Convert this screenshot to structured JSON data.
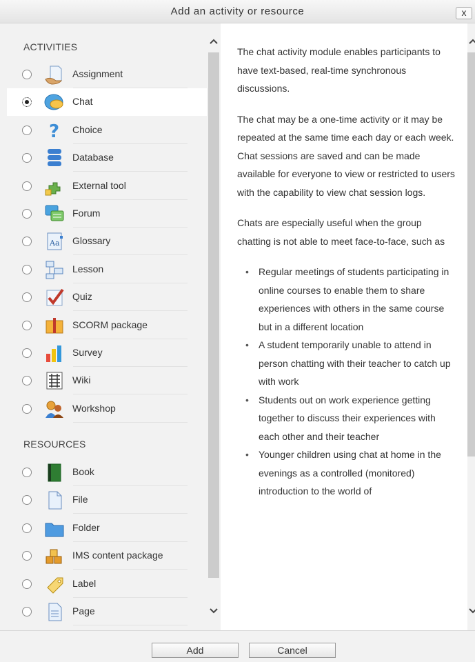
{
  "dialog": {
    "title": "Add an activity or resource",
    "close_label": "x"
  },
  "activities": {
    "heading": "ACTIVITIES",
    "items": [
      {
        "label": "Assignment",
        "icon": "assignment-icon",
        "selected": false
      },
      {
        "label": "Chat",
        "icon": "chat-icon",
        "selected": true
      },
      {
        "label": "Choice",
        "icon": "choice-icon",
        "selected": false
      },
      {
        "label": "Database",
        "icon": "database-icon",
        "selected": false
      },
      {
        "label": "External tool",
        "icon": "external-tool-icon",
        "selected": false
      },
      {
        "label": "Forum",
        "icon": "forum-icon",
        "selected": false
      },
      {
        "label": "Glossary",
        "icon": "glossary-icon",
        "selected": false
      },
      {
        "label": "Lesson",
        "icon": "lesson-icon",
        "selected": false
      },
      {
        "label": "Quiz",
        "icon": "quiz-icon",
        "selected": false
      },
      {
        "label": "SCORM package",
        "icon": "scorm-icon",
        "selected": false
      },
      {
        "label": "Survey",
        "icon": "survey-icon",
        "selected": false
      },
      {
        "label": "Wiki",
        "icon": "wiki-icon",
        "selected": false
      },
      {
        "label": "Workshop",
        "icon": "workshop-icon",
        "selected": false
      }
    ]
  },
  "resources": {
    "heading": "RESOURCES",
    "items": [
      {
        "label": "Book",
        "icon": "book-icon",
        "selected": false
      },
      {
        "label": "File",
        "icon": "file-icon",
        "selected": false
      },
      {
        "label": "Folder",
        "icon": "folder-icon",
        "selected": false
      },
      {
        "label": "IMS content package",
        "icon": "ims-package-icon",
        "selected": false
      },
      {
        "label": "Label",
        "icon": "label-icon",
        "selected": false
      },
      {
        "label": "Page",
        "icon": "page-icon",
        "selected": false
      }
    ]
  },
  "description": {
    "paragraphs": [
      "The chat activity module enables participants to have text-based, real-time synchronous discussions.",
      "The chat may be a one-time activity or it may be repeated at the same time each day or each week. Chat sessions are saved and can be made available for everyone to view or restricted to users with the capability to view chat session logs.",
      "Chats are especially useful when the group chatting is not able to meet face-to-face, such as"
    ],
    "bullets": [
      "Regular meetings of students participating in online courses to enable them to share experiences with others in the same course but in a different location",
      "A student temporarily unable to attend in person chatting with their teacher to catch up with work",
      "Students out on work experience getting together to discuss their experiences with each other and their teacher",
      "Younger children using chat at home in the evenings as a controlled (monitored) introduction to the world of"
    ]
  },
  "footer": {
    "add_label": "Add",
    "cancel_label": "Cancel"
  },
  "colors": {
    "panel_bg": "#f2f2f2",
    "selected_row_bg": "#ffffff",
    "scroll_thumb": "#cccccc"
  }
}
